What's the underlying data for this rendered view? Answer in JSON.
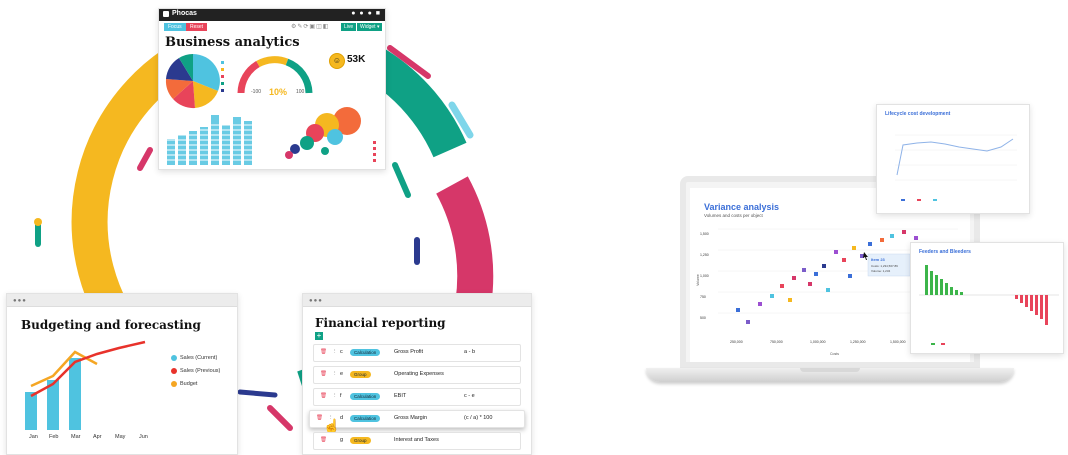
{
  "phocas": {
    "app_title": "Phocas",
    "btn_focus": "Focus",
    "btn_reset": "Reset",
    "btn_live": "Live",
    "btn_widget": "Widget ▾",
    "heading": "Business analytics",
    "kpi_value": "53K",
    "gauge_min": "-100",
    "gauge_value": "10%",
    "gauge_max": "100",
    "colors": {
      "teal": "#0fa185",
      "yellow": "#f5b820",
      "red": "#e8445a",
      "blue": "#4fc3e0",
      "orange": "#f36b3b",
      "navy": "#2b3a8f",
      "pink": "#d63769"
    }
  },
  "budgeting": {
    "title": "Budgeting and forecasting",
    "legend": [
      {
        "label": "Sales (Current)",
        "color": "#4fc3e0"
      },
      {
        "label": "Sales (Previous)",
        "color": "#e8322b"
      },
      {
        "label": "Budget",
        "color": "#f5a623"
      }
    ],
    "months": [
      "Jan",
      "Feb",
      "Mar",
      "Apr",
      "May",
      "Jun"
    ]
  },
  "financial": {
    "title": "Financial reporting",
    "rows": [
      {
        "code": "c",
        "tag": "Calculation",
        "tag_color": "#4fc3e0",
        "label": "Gross Profit",
        "formula": "a - b"
      },
      {
        "code": "e",
        "tag": "Group",
        "tag_color": "#f5b820",
        "label": "Operating Expenses",
        "formula": ""
      },
      {
        "code": "f",
        "tag": "Calculation",
        "tag_color": "#4fc3e0",
        "label": "EBIT",
        "formula": "c - e"
      },
      {
        "code": "d",
        "tag": "Calculation",
        "tag_color": "#4fc3e0",
        "label": "Gross Margin",
        "formula": "(c / a) * 100"
      },
      {
        "code": "g",
        "tag": "Group",
        "tag_color": "#f5b820",
        "label": "Interest and Taxes",
        "formula": ""
      }
    ]
  },
  "variance": {
    "title": "Variance analysis",
    "subtitle": "Volumes and costs per object",
    "tooltip_title": "Item 23",
    "tooltip_line1": "Costs: 1,234,567.89",
    "tooltip_line2": "Volume: 1,234",
    "y_ticks": [
      "1,500",
      "1,250",
      "1,000",
      "750",
      "500"
    ],
    "x_ticks": [
      "250,000",
      "750,000",
      "1,000,000",
      "1,250,000",
      "1,500,000",
      "1,750,000"
    ],
    "x_label": "Costs",
    "y_label": "Volume"
  },
  "lifecycle": {
    "title": "Lifecycle cost development"
  },
  "feeders": {
    "title": "Feeders and Bleeders"
  }
}
